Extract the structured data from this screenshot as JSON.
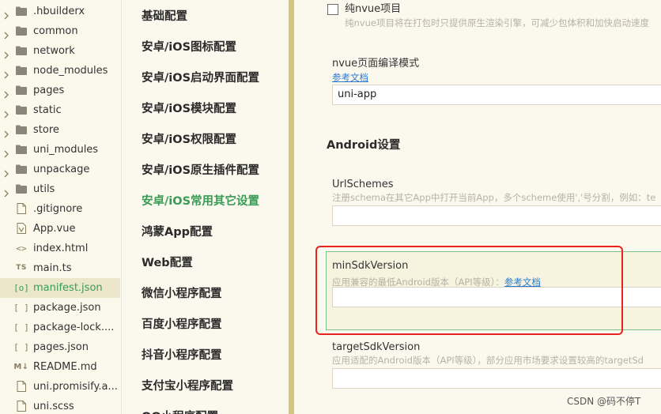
{
  "file_tree": {
    "items": [
      {
        "label": ".hbuilderx",
        "type": "folder",
        "icon": "folder-icon"
      },
      {
        "label": "common",
        "type": "folder",
        "icon": "folder-icon"
      },
      {
        "label": "network",
        "type": "folder",
        "icon": "folder-icon"
      },
      {
        "label": "node_modules",
        "type": "folder",
        "icon": "folder-icon"
      },
      {
        "label": "pages",
        "type": "folder",
        "icon": "folder-icon"
      },
      {
        "label": "static",
        "type": "folder",
        "icon": "folder-icon"
      },
      {
        "label": "store",
        "type": "folder",
        "icon": "folder-icon"
      },
      {
        "label": "uni_modules",
        "type": "folder",
        "icon": "folder-icon"
      },
      {
        "label": "unpackage",
        "type": "folder",
        "icon": "folder-icon"
      },
      {
        "label": "utils",
        "type": "folder",
        "icon": "folder-icon"
      },
      {
        "label": ".gitignore",
        "type": "file",
        "icon": "file-icon"
      },
      {
        "label": "App.vue",
        "type": "file",
        "icon": "vue-file-icon"
      },
      {
        "label": "index.html",
        "type": "file",
        "icon": "html-file-icon"
      },
      {
        "label": "main.ts",
        "type": "file",
        "icon": "ts-file-icon",
        "badge": "TS"
      },
      {
        "label": "manifest.json",
        "type": "file",
        "icon": "manifest-json-icon",
        "selected": true
      },
      {
        "label": "package.json",
        "type": "file",
        "icon": "json-file-icon"
      },
      {
        "label": "package-lock....",
        "type": "file",
        "icon": "json-file-icon"
      },
      {
        "label": "pages.json",
        "type": "file",
        "icon": "json-file-icon"
      },
      {
        "label": "README.md",
        "type": "file",
        "icon": "markdown-file-icon",
        "badge": "M↓"
      },
      {
        "label": "uni.promisify.a...",
        "type": "file",
        "icon": "file-icon"
      },
      {
        "label": "uni.scss",
        "type": "file",
        "icon": "scss-file-icon"
      }
    ]
  },
  "settings_nav": {
    "items": [
      {
        "label": "基础配置"
      },
      {
        "label": "安卓/iOS图标配置"
      },
      {
        "label": "安卓/iOS启动界面配置"
      },
      {
        "label": "安卓/iOS模块配置"
      },
      {
        "label": "安卓/iOS权限配置"
      },
      {
        "label": "安卓/iOS原生插件配置"
      },
      {
        "label": "安卓/iOS常用其它设置",
        "active": true
      },
      {
        "label": "鸿蒙App配置"
      },
      {
        "label": "Web配置"
      },
      {
        "label": "微信小程序配置"
      },
      {
        "label": "百度小程序配置"
      },
      {
        "label": "抖音小程序配置"
      },
      {
        "label": "支付宝小程序配置"
      },
      {
        "label": "QQ小程序配置"
      }
    ]
  },
  "content": {
    "nvue_only": {
      "label": "纯nvue项目",
      "hint": "纯nvue项目将在打包时只提供原生渲染引擎，可减少包体积和加快启动速度",
      "checked": false
    },
    "nvue_compile": {
      "label": "nvue页面编译模式",
      "link": "参考文档",
      "value": "uni-app"
    },
    "android_section": {
      "title": "Android设置"
    },
    "url_schemes": {
      "label": "UrlSchemes",
      "hint": "注册schema在其它App中打开当前App，多个scheme使用','号分割，例如：te",
      "value": ""
    },
    "min_sdk": {
      "label": "minSdkVersion",
      "hint": "应用兼容的最低Android版本（API等级）：",
      "link": "参考文档",
      "value": ""
    },
    "target_sdk": {
      "label": "targetSdkVersion",
      "hint": "应用适配的Android版本（API等级），部分应用市场要求设置较高的targetSd",
      "value": ""
    }
  },
  "watermark": "CSDN @码不停T",
  "colors": {
    "accent_green": "#3a9c56",
    "highlight_border": "#e8231f",
    "nav_scrollbar": "#d5c779"
  }
}
